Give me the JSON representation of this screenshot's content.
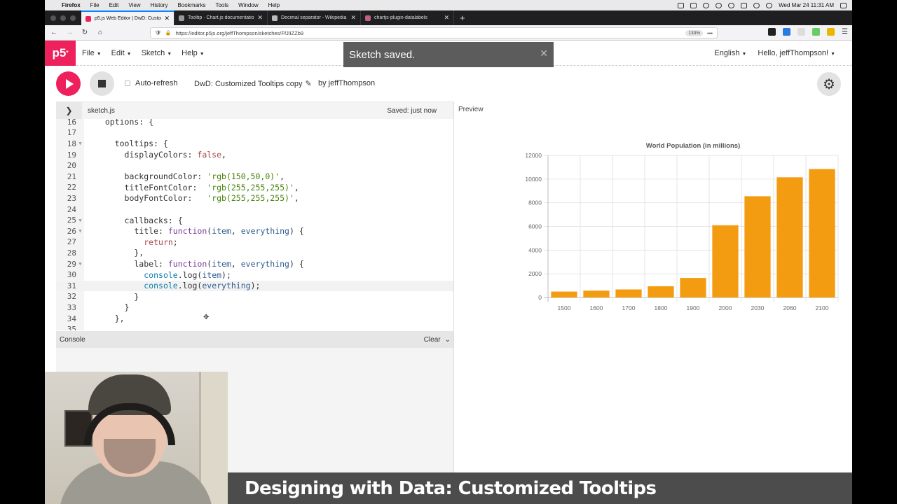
{
  "os_menubar": {
    "items": [
      "Firefox",
      "File",
      "Edit",
      "View",
      "History",
      "Bookmarks",
      "Tools",
      "Window",
      "Help"
    ],
    "clock": "Wed Mar 24  11:31 AM"
  },
  "browser": {
    "tabs": [
      {
        "label": "p5.js Web Editor | DwD: Custom",
        "active": true,
        "color": "#ed225d"
      },
      {
        "label": "Tooltip · Chart.js documentatio",
        "active": false,
        "color": "#999999"
      },
      {
        "label": "Decimal separator - Wikipedia",
        "active": false,
        "color": "#bbbbbb"
      },
      {
        "label": "chartjs-plugin-datalabels",
        "active": false,
        "color": "#c06080"
      }
    ],
    "url": "https://editor.p5js.org/jeffThompson/sketches/FfJlIZZb9",
    "zoom": "133%"
  },
  "p5": {
    "logo": "p5",
    "menus": [
      "File",
      "Edit",
      "Sketch",
      "Help"
    ],
    "language": "English",
    "greeting": "Hello, jeffThompson!",
    "toast": "Sketch saved.",
    "auto_refresh_label": "Auto-refresh",
    "sketch_name": "DwD: Customized Tooltips copy",
    "by_user": "by jeffThompson",
    "file_name": "sketch.js",
    "saved_status": "Saved: just now",
    "preview_label": "Preview",
    "console_label": "Console",
    "clear_label": "Clear"
  },
  "code_lines": [
    {
      "n": "16",
      "text": "  options: {",
      "fold": false
    },
    {
      "n": "17",
      "text": "",
      "fold": false
    },
    {
      "n": "18",
      "text": "    tooltips: {",
      "fold": true
    },
    {
      "n": "19",
      "text": "      displayColors: false,",
      "fold": false
    },
    {
      "n": "20",
      "text": "",
      "fold": false
    },
    {
      "n": "21",
      "text": "      backgroundColor: 'rgb(150,50,0)',",
      "fold": false
    },
    {
      "n": "22",
      "text": "      titleFontColor:  'rgb(255,255,255)',",
      "fold": false
    },
    {
      "n": "23",
      "text": "      bodyFontColor:   'rgb(255,255,255)',",
      "fold": false
    },
    {
      "n": "24",
      "text": "",
      "fold": false
    },
    {
      "n": "25",
      "text": "      callbacks: {",
      "fold": true
    },
    {
      "n": "26",
      "text": "        title: function(item, everything) {",
      "fold": true
    },
    {
      "n": "27",
      "text": "          return;",
      "fold": false
    },
    {
      "n": "28",
      "text": "        },",
      "fold": false
    },
    {
      "n": "29",
      "text": "        label: function(item, everything) {",
      "fold": true
    },
    {
      "n": "30",
      "text": "          console.log(item);",
      "fold": false
    },
    {
      "n": "31",
      "text": "          console.log(everything);",
      "fold": false,
      "active": true
    },
    {
      "n": "32",
      "text": "        }",
      "fold": false
    },
    {
      "n": "33",
      "text": "      }",
      "fold": false
    },
    {
      "n": "34",
      "text": "    },",
      "fold": false
    },
    {
      "n": "35",
      "text": "",
      "fold": false
    }
  ],
  "chart_data": {
    "type": "bar",
    "title": "World Population (in millions)",
    "categories": [
      "1500",
      "1600",
      "1700",
      "1800",
      "1900",
      "2000",
      "2030",
      "2060",
      "2100"
    ],
    "values": [
      500,
      580,
      680,
      950,
      1650,
      6100,
      8550,
      10150,
      10850
    ],
    "ylim": [
      0,
      12000
    ],
    "yticks": [
      0,
      2000,
      4000,
      6000,
      8000,
      10000,
      12000
    ],
    "bar_color": "#f39c12",
    "grid": true
  },
  "video_title": "Designing with Data: Customized Tooltips"
}
